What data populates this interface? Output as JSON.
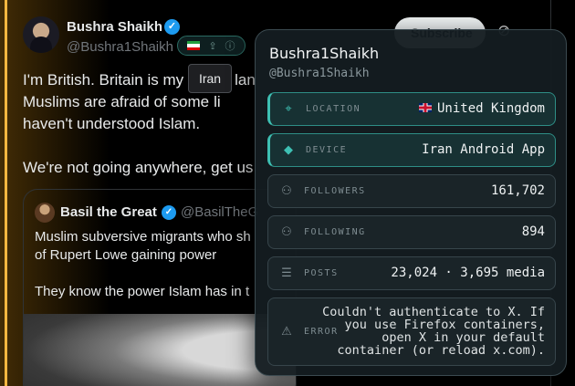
{
  "tweet": {
    "author_name": "Bushra Shaikh",
    "author_handle": "@Bushra1Shaikh",
    "tooltip": "Iran",
    "subscribe_label": "Subscribe",
    "lines": [
      "I'm British. Britain is my",
      "Muslims are afraid of some",
      "haven't understood Islam.",
      "We're not going anywhere, get us"
    ],
    "text_line1_tail": "lan",
    "text_line2_tail": "li",
    "quote": {
      "author_name": "Basil the Great",
      "author_handle": "@BasilTheG",
      "lines": [
        "Muslim subversive migrants who sh",
        "of Rupert Lowe gaining power",
        "They know the power Islam has in t"
      ]
    }
  },
  "card": {
    "name": "Bushra1Shaikh",
    "handle": "@Bushra1Shaikh",
    "rows": [
      {
        "label": "LOCATION",
        "value": "United Kingdom",
        "icon": "map-pin-icon"
      },
      {
        "label": "DEVICE",
        "value": "Iran Android App",
        "icon": "android-icon"
      },
      {
        "label": "FOLLOWERS",
        "value": "161,702",
        "icon": "users-icon"
      },
      {
        "label": "FOLLOWING",
        "value": "894",
        "icon": "users-icon"
      },
      {
        "label": "POSTS",
        "value": "23,024 · 3,695 media",
        "icon": "list-icon"
      },
      {
        "label": "ERROR",
        "value": "Couldn't authenticate to X. If\nyou use Firefox containers,\nopen X in your default\ncontainer (or reload x.com).",
        "icon": "warning-icon"
      }
    ]
  },
  "colors": {
    "accent_gold": "#f4b740",
    "accent_teal": "#3ec0b3",
    "verified_blue": "#1d9bf0"
  }
}
